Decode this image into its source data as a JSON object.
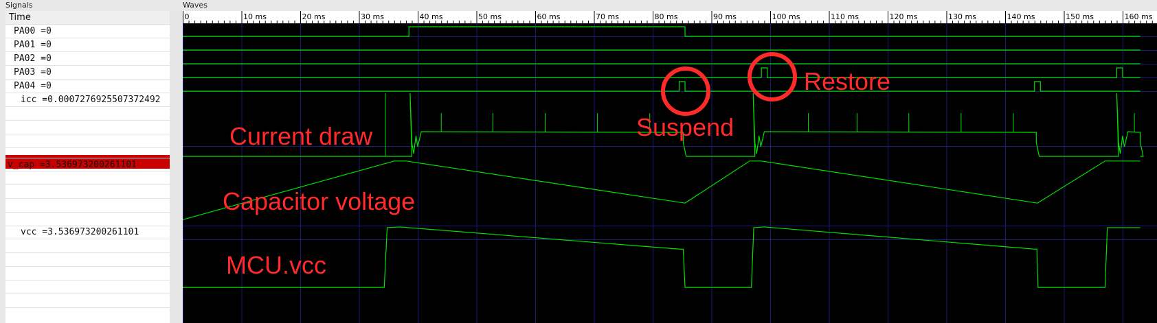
{
  "panes": {
    "signals_title": "Signals",
    "waves_title": "Waves"
  },
  "signals": {
    "header": "Time",
    "items": [
      {
        "name": "PA00",
        "value": "0"
      },
      {
        "name": "PA01",
        "value": "0"
      },
      {
        "name": "PA02",
        "value": "0"
      },
      {
        "name": "PA03",
        "value": "0"
      },
      {
        "name": "PA04",
        "value": "0"
      },
      {
        "name": "icc",
        "value": "0.0007276925507372492"
      },
      {
        "name": "v_cap",
        "value": "3.536973200261101"
      },
      {
        "name": "vcc",
        "value": "3.536973200261101"
      }
    ]
  },
  "timeline": {
    "unit": "ms",
    "tick_labels": [
      "0",
      "10 ms",
      "20 ms",
      "30 ms",
      "40 ms",
      "50 ms",
      "60 ms",
      "70 ms",
      "80 ms",
      "90 ms",
      "100 ms",
      "110 ms",
      "120 ms",
      "130 ms",
      "140 ms",
      "150 ms",
      "160 ms"
    ]
  },
  "annotations": {
    "current": "Current draw",
    "capacitor": "Capacitor voltage",
    "mcu": "MCU.vcc",
    "suspend": "Suspend",
    "restore": "Restore"
  },
  "colors": {
    "wave": "#00e000",
    "annotation": "#ff2a2a",
    "grid": "#1a1a7a",
    "selected_row": "#c80000"
  },
  "waves": {
    "PA00": [
      [
        0,
        0
      ],
      [
        38.5,
        0
      ],
      [
        38.5,
        1
      ],
      [
        85.5,
        1
      ],
      [
        85.5,
        0
      ],
      [
        163,
        0
      ]
    ],
    "PA01": [
      [
        0,
        0
      ],
      [
        163,
        0
      ]
    ],
    "PA02": [
      [
        0,
        0
      ],
      [
        163,
        0
      ]
    ],
    "PA03": [
      [
        0,
        0
      ],
      [
        98.5,
        0
      ],
      [
        98.5,
        1
      ],
      [
        99.5,
        1
      ],
      [
        99.5,
        0
      ],
      [
        159,
        0
      ],
      [
        159,
        1
      ],
      [
        160,
        1
      ],
      [
        160,
        0
      ],
      [
        163,
        0
      ]
    ],
    "PA04": [
      [
        0,
        0
      ],
      [
        84.5,
        0
      ],
      [
        84.5,
        1
      ],
      [
        85.5,
        1
      ],
      [
        85.5,
        0
      ],
      [
        145,
        0
      ],
      [
        145,
        1
      ],
      [
        146,
        1
      ],
      [
        146,
        0
      ],
      [
        163,
        0
      ]
    ],
    "icc_segments": [
      [
        0,
        34.3
      ],
      [
        39,
        85.2
      ],
      [
        97.4,
        145.3
      ],
      [
        159.3,
        163
      ]
    ],
    "icc_spikes": [
      44,
      52.8,
      61.7,
      70.6,
      79.5,
      106.5,
      114.8,
      123.6,
      132.5,
      141.4,
      162
    ],
    "v_cap": [
      [
        0,
        0.05
      ],
      [
        36,
        0.97
      ],
      [
        38,
        0.97
      ],
      [
        85.5,
        0.31
      ],
      [
        96.5,
        0.97
      ],
      [
        98.5,
        0.97
      ],
      [
        145.5,
        0.31
      ],
      [
        157,
        0.97
      ],
      [
        163,
        0.97
      ]
    ],
    "vcc": [
      [
        0,
        0.07
      ],
      [
        34.3,
        0.07
      ],
      [
        34.8,
        0.96
      ],
      [
        37,
        0.97
      ],
      [
        84.5,
        0.64
      ],
      [
        85.2,
        0.64
      ],
      [
        85.5,
        0.07
      ],
      [
        96.8,
        0.07
      ],
      [
        97.2,
        0.96
      ],
      [
        99,
        0.97
      ],
      [
        145,
        0.64
      ],
      [
        145.4,
        0.64
      ],
      [
        145.6,
        0.07
      ],
      [
        157,
        0.07
      ],
      [
        157.4,
        0.96
      ],
      [
        163,
        0.96
      ]
    ]
  }
}
